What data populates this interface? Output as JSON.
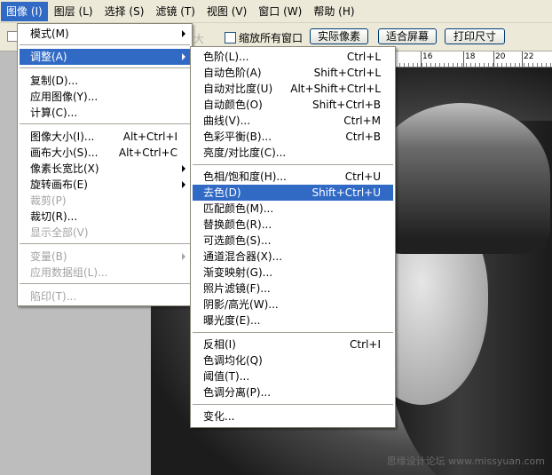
{
  "menubar": {
    "items": [
      "图像 (I)",
      "图层 (L)",
      "选择 (S)",
      "滤镜 (T)",
      "视图 (V)",
      "窗口 (W)",
      "帮助 (H)"
    ],
    "active_index": 0
  },
  "options": {
    "ghost_text": "大",
    "zoom_all_label": "缩放所有窗口",
    "actual_pixels": "实际像素",
    "fit_screen": "适合屏幕",
    "print_size": "打印尺寸"
  },
  "ruler": {
    "labels": [
      "16",
      "18",
      "20",
      "22"
    ]
  },
  "image_menu": {
    "mode": "模式(M)",
    "adjust": "调整(A)",
    "duplicate": "复制(D)...",
    "apply_image": "应用图像(Y)...",
    "calculate": "计算(C)...",
    "image_size": "图像大小(I)...",
    "image_size_sc": "Alt+Ctrl+I",
    "canvas_size": "画布大小(S)...",
    "canvas_size_sc": "Alt+Ctrl+C",
    "pixel_aspect": "像素长宽比(X)",
    "rotate_canvas": "旋转画布(E)",
    "crop": "裁剪(P)",
    "trim": "裁切(R)...",
    "reveal_all": "显示全部(V)",
    "variables": "变量(B)",
    "apply_dataset": "应用数据组(L)...",
    "trap": "陷印(T)..."
  },
  "adjust_menu": {
    "levels": "色阶(L)...",
    "levels_sc": "Ctrl+L",
    "auto_levels": "自动色阶(A)",
    "auto_levels_sc": "Shift+Ctrl+L",
    "auto_contrast": "自动对比度(U)",
    "auto_contrast_sc": "Alt+Shift+Ctrl+L",
    "auto_color": "自动颜色(O)",
    "auto_color_sc": "Shift+Ctrl+B",
    "curves": "曲线(V)...",
    "curves_sc": "Ctrl+M",
    "color_balance": "色彩平衡(B)...",
    "color_balance_sc": "Ctrl+B",
    "brightness_contrast": "亮度/对比度(C)...",
    "hue_saturation": "色相/饱和度(H)...",
    "hue_saturation_sc": "Ctrl+U",
    "desaturate": "去色(D)",
    "desaturate_sc": "Shift+Ctrl+U",
    "match_color": "匹配颜色(M)...",
    "replace_color": "替换颜色(R)...",
    "selective_color": "可选颜色(S)...",
    "channel_mixer": "通道混合器(X)...",
    "gradient_map": "渐变映射(G)...",
    "photo_filter": "照片滤镜(F)...",
    "shadow_highlight": "阴影/高光(W)...",
    "exposure": "曝光度(E)...",
    "invert": "反相(I)",
    "invert_sc": "Ctrl+I",
    "equalize": "色调均化(Q)",
    "threshold": "阈值(T)...",
    "posterize": "色调分离(P)...",
    "variations": "变化..."
  },
  "watermark": "思缘设计论坛 www.missyuan.com",
  "colors": {
    "highlight": "#316ac5",
    "menubar_bg": "#ece9d8"
  }
}
